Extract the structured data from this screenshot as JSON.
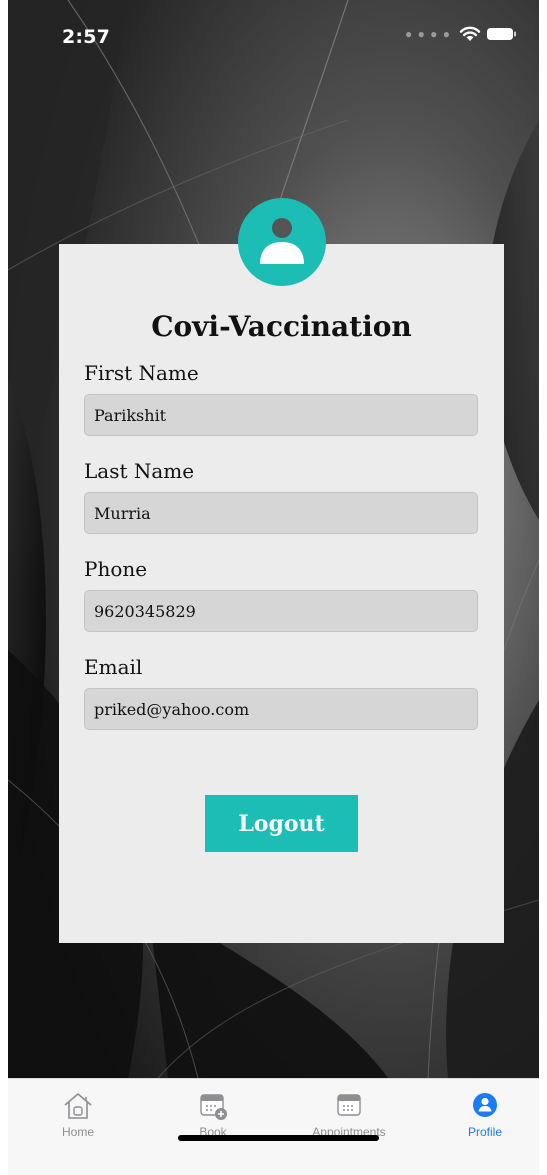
{
  "status_bar": {
    "time": "2:57"
  },
  "app": {
    "title": "Covi-Vaccination"
  },
  "profile": {
    "fields": [
      {
        "label": "First Name",
        "value": "Parikshit"
      },
      {
        "label": "Last Name",
        "value": "Murria"
      },
      {
        "label": "Phone",
        "value": "9620345829"
      },
      {
        "label": "Email",
        "value": "priked@yahoo.com"
      }
    ],
    "logout_label": "Logout"
  },
  "tabs": [
    {
      "label": "Home",
      "icon": "home-icon",
      "active": false
    },
    {
      "label": "Book",
      "icon": "calendar-plus-icon",
      "active": false
    },
    {
      "label": "Appointments",
      "icon": "calendar-icon",
      "active": false
    },
    {
      "label": "Profile",
      "icon": "profile-icon",
      "active": true
    }
  ],
  "colors": {
    "accent": "#1bbdb5",
    "tab_active": "#1a7cf5",
    "tab_inactive": "#8e8e93",
    "card": "#ececec"
  }
}
